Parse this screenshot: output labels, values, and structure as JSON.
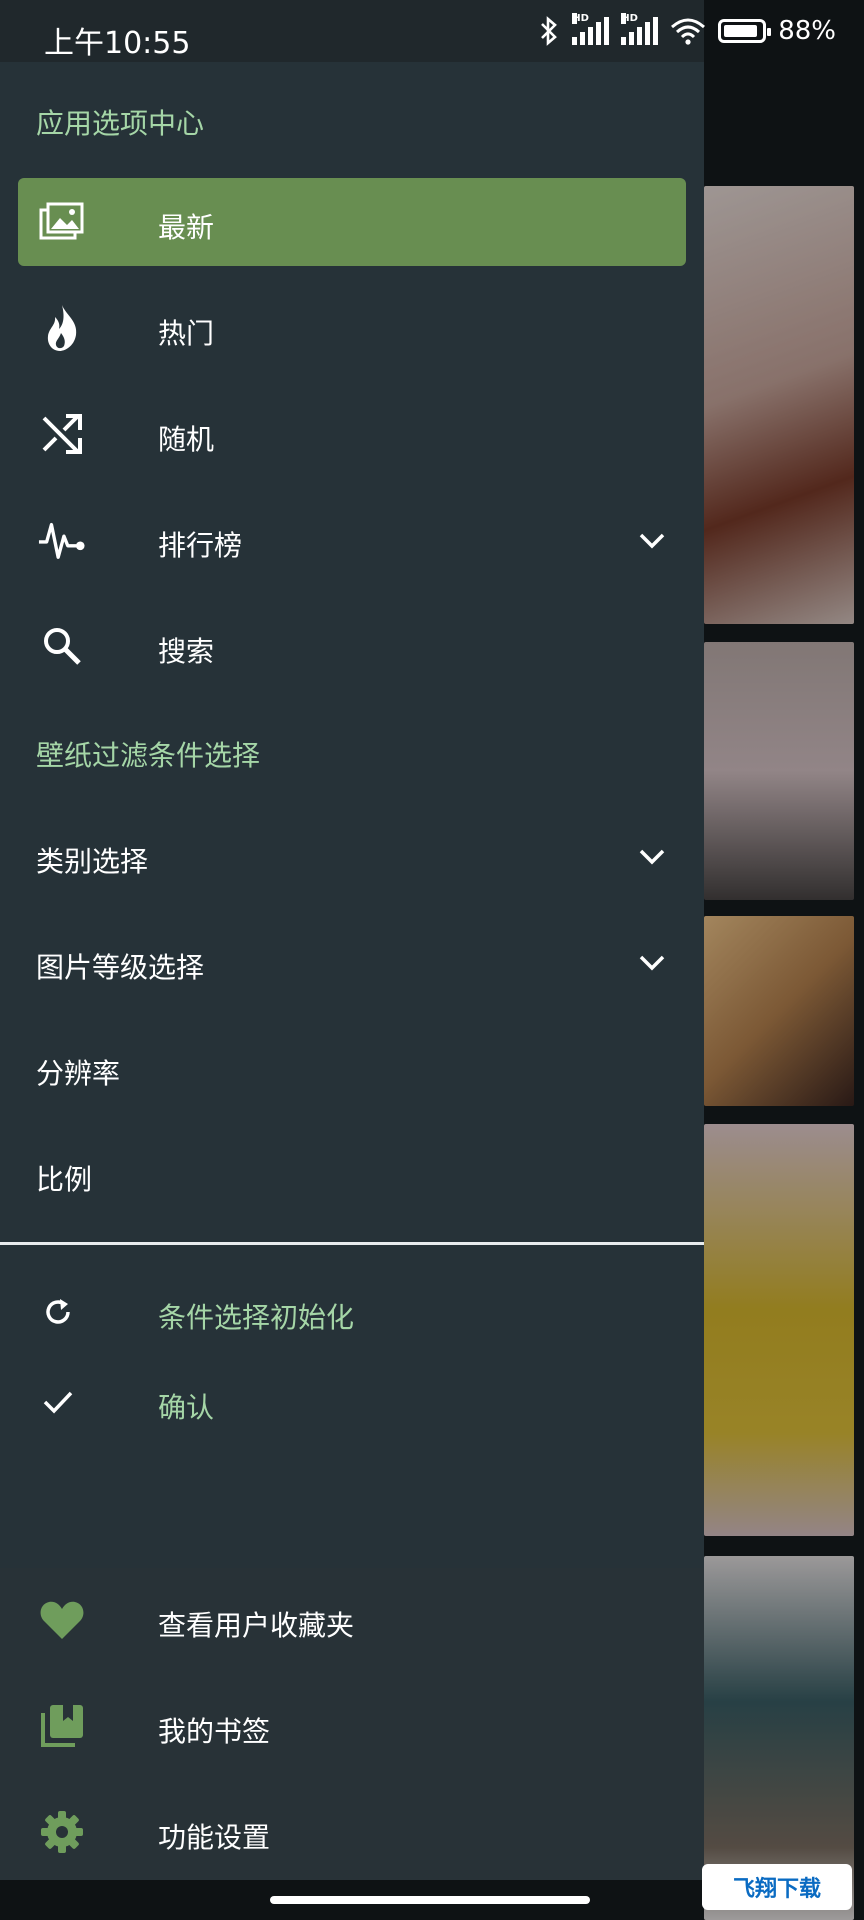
{
  "status_bar": {
    "time": "上午10:55",
    "battery": "88%",
    "signal_label": "HD"
  },
  "drawer": {
    "header_title": "应用选项中心",
    "nav_items": [
      {
        "label": "最新",
        "icon": "image-icon",
        "active": true
      },
      {
        "label": "热门",
        "icon": "fire-icon"
      },
      {
        "label": "随机",
        "icon": "shuffle-icon"
      },
      {
        "label": "排行榜",
        "icon": "pulse-icon",
        "expandable": true
      },
      {
        "label": "搜索",
        "icon": "search-icon"
      }
    ],
    "filter_title": "壁纸过滤条件选择",
    "filters": [
      {
        "label": "类别选择",
        "expandable": true
      },
      {
        "label": "图片等级选择",
        "expandable": true
      },
      {
        "label": "分辨率"
      },
      {
        "label": "比例"
      }
    ],
    "actions": [
      {
        "label": "条件选择初始化",
        "icon": "refresh-icon"
      },
      {
        "label": "确认",
        "icon": "check-icon"
      }
    ],
    "footer_items": [
      {
        "label": "查看用户收藏夹",
        "icon": "heart-icon"
      },
      {
        "label": "我的书签",
        "icon": "bookmarks-icon"
      },
      {
        "label": "功能设置",
        "icon": "gear-icon"
      }
    ]
  },
  "watermark": "飞翔下载",
  "colors": {
    "drawer_bg": "#263238",
    "accent_green": "#688e51",
    "section_text": "#a5d6a7"
  }
}
